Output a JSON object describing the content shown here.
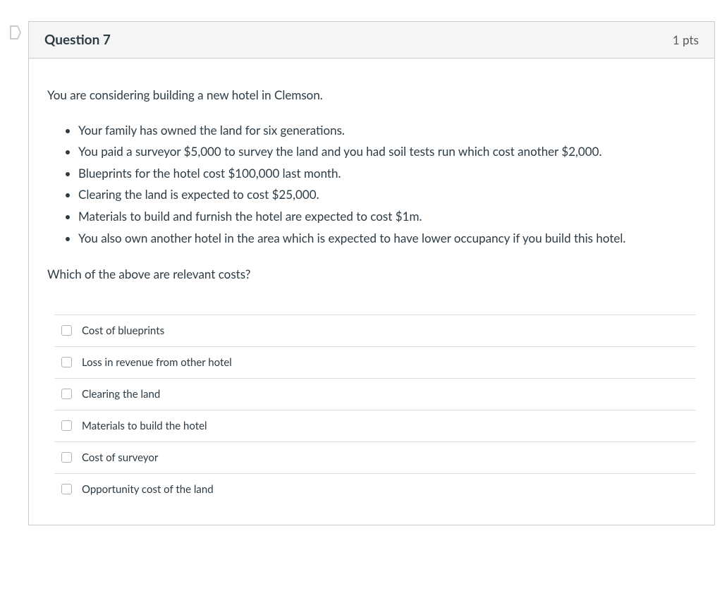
{
  "header": {
    "title": "Question 7",
    "points": "1 pts"
  },
  "body": {
    "intro": "You are considering building a new hotel in Clemson.",
    "facts": [
      "Your family has owned the land for six generations.",
      "You paid a surveyor $5,000 to survey the land and you had soil tests run which cost another $2,000.",
      "Blueprints for the hotel cost $100,000 last month.",
      "Clearing the land is expected to cost $25,000.",
      "Materials to build and furnish the hotel are expected to cost $1m.",
      "You also own another hotel in the area which is expected to have lower occupancy if you build this hotel."
    ],
    "prompt": "Which of the above are relevant costs?"
  },
  "answers": [
    "Cost of blueprints",
    "Loss in revenue from other hotel",
    "Clearing the land",
    "Materials to build the hotel",
    "Cost of surveyor",
    "Opportunity cost of the land"
  ]
}
